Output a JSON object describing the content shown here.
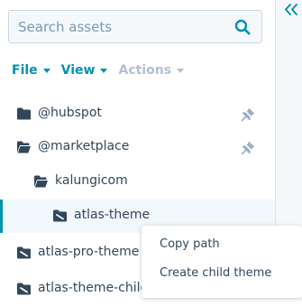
{
  "search": {
    "placeholder": "Search assets",
    "value": ""
  },
  "menu": {
    "file": "File",
    "view": "View",
    "actions": "Actions"
  },
  "tree": [
    {
      "label": "@hubspot",
      "icon": "folder-icon",
      "pinned": true
    },
    {
      "label": "@marketplace",
      "icon": "folder-open-icon",
      "pinned": true
    },
    {
      "label": "kalungicom",
      "icon": "folder-open-icon"
    },
    {
      "label": "atlas-theme",
      "icon": "theme-folder-icon",
      "selected": true
    },
    {
      "label": "atlas-pro-theme",
      "icon": "theme-folder-icon"
    },
    {
      "label": "atlas-theme-child",
      "icon": "theme-folder-icon"
    }
  ],
  "context_menu": {
    "items": [
      "Copy path",
      "Create child theme"
    ]
  },
  "colors": {
    "accent": "#0091ae",
    "text": "#33475b",
    "disabled": "#b0c1d4",
    "border": "#cbd6e2",
    "selected_bg": "#f0f8fb"
  }
}
